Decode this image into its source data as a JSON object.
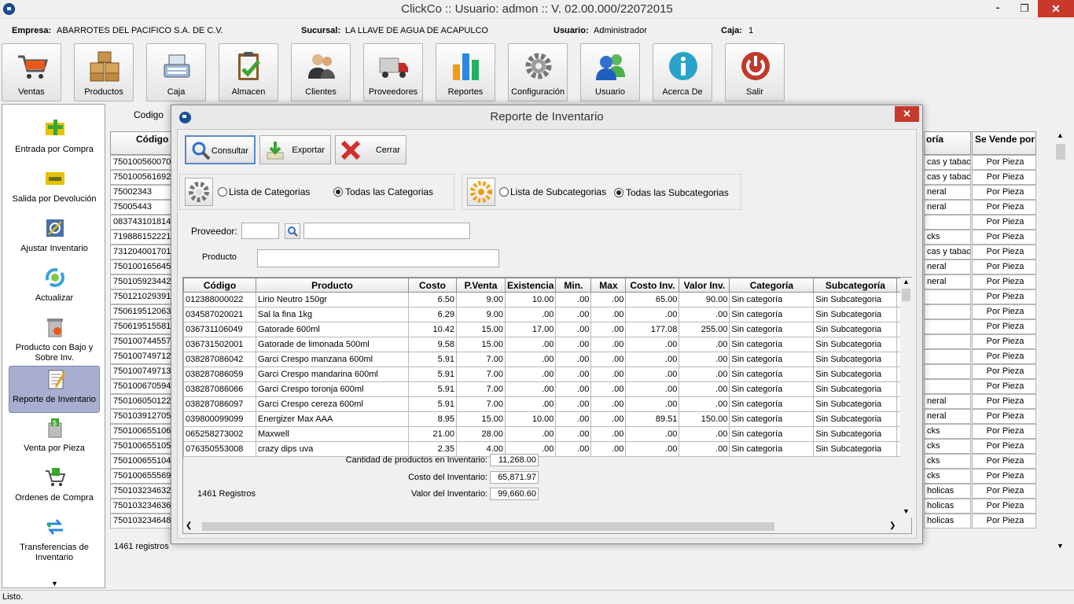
{
  "window": {
    "title": "ClickCo :: Usuario: admon :: V. 02.00.000/22072015"
  },
  "info": {
    "empresa_label": "Empresa:",
    "empresa_value": "ABARROTES DEL PACIFICO S.A. DE C.V.",
    "sucursal_label": "Sucursal:",
    "sucursal_value": "LA LLAVE DE AGUA DE ACAPULCO",
    "usuario_label": "Usuario:",
    "usuario_value": "Administrador",
    "caja_label": "Caja:",
    "caja_value": "1"
  },
  "toolbar": [
    {
      "label": "Ventas",
      "icon": "cart-icon"
    },
    {
      "label": "Productos",
      "icon": "boxes-icon"
    },
    {
      "label": "Caja",
      "icon": "cash-register-icon"
    },
    {
      "label": "Almacen",
      "icon": "clipboard-check-icon"
    },
    {
      "label": "Clientes",
      "icon": "customers-icon"
    },
    {
      "label": "Proveedores",
      "icon": "truck-icon"
    },
    {
      "label": "Reportes",
      "icon": "bar-chart-icon"
    },
    {
      "label": "Configuración",
      "icon": "gear-icon"
    },
    {
      "label": "Usuario",
      "icon": "users-icon"
    },
    {
      "label": "Acerca De",
      "icon": "info-icon"
    },
    {
      "label": "Salir",
      "icon": "power-icon"
    }
  ],
  "sidebar": [
    {
      "label": "Entrada por Compra",
      "icon": "plus-box-icon"
    },
    {
      "label": "Salida por Devolución",
      "icon": "minus-box-icon"
    },
    {
      "label": "Ajustar Inventario",
      "icon": "adjust-icon"
    },
    {
      "label": "Actualizar",
      "icon": "refresh-icon"
    },
    {
      "label": "Producto con Bajo y Sobre Inv.",
      "icon": "trash-box-icon"
    },
    {
      "label": "Reporte de Inventario",
      "icon": "report-icon"
    },
    {
      "label": "Venta por Pieza",
      "icon": "money-box-icon"
    },
    {
      "label": "Ordenes de Compra",
      "icon": "cart-order-icon"
    },
    {
      "label": "Transferencias de Inventario",
      "icon": "transfer-icon"
    }
  ],
  "background": {
    "codigo_label": "Codigo",
    "col_codigo": "Código",
    "col_categoria": "oría",
    "col_se_vende": "Se Vende por",
    "codes": [
      "750100560070",
      "750100561692",
      "75002343",
      "75005443",
      "083743101814",
      "719886152221",
      "731204001701",
      "750100165645",
      "750105923442",
      "750121029391",
      "750619512063",
      "750619515581",
      "750100744557",
      "750100749712",
      "750100749713",
      "750100670594",
      "750106050122",
      "750103912705",
      "750100655106",
      "750100655105",
      "750100655104",
      "750100655569",
      "750103234632",
      "750103234636",
      "750103234648"
    ],
    "categorias": [
      "cas y tabaco",
      "cas y tabaco",
      "neral",
      "neral",
      "",
      "cks",
      "cas y tabaco",
      "neral",
      "neral",
      "",
      "",
      "",
      "",
      "",
      "",
      "",
      "neral",
      "neral",
      "cks",
      "cks",
      "cks",
      "cks",
      "holicas",
      "holicas",
      "holicas"
    ],
    "se_vende": "Por Pieza",
    "registros": "1461 registros"
  },
  "dialog": {
    "title": "Reporte de Inventario",
    "buttons": {
      "consultar": "Consultar",
      "exportar": "Exportar",
      "cerrar": "Cerrar"
    },
    "categorias": {
      "lista": "Lista de Categorias",
      "todas": "Todas las Categorias",
      "selected": "todas"
    },
    "subcategorias": {
      "lista": "Lista de Subcategorias",
      "todas": "Todas las Subcategorias",
      "selected": "todas"
    },
    "proveedor_label": "Proveedor:",
    "producto_label": "Producto",
    "columns": [
      "Código",
      "Producto",
      "Costo",
      "P.Venta",
      "Existencia",
      "Min.",
      "Max",
      "Costo Inv.",
      "Valor Inv.",
      "Categoría",
      "Subcategoría"
    ],
    "rows": [
      [
        "012388000022",
        "Lirio Neutro 150gr",
        "6.50",
        "9.00",
        "10.00",
        ".00",
        ".00",
        "65.00",
        "90.00",
        "Sin categoría",
        "Sin Subcategoria"
      ],
      [
        "034587020021",
        "Sal la fina 1kg",
        "6.29",
        "9.00",
        ".00",
        ".00",
        ".00",
        ".00",
        ".00",
        "Sin categoría",
        "Sin Subcategoria"
      ],
      [
        "036731106049",
        "Gatorade 600ml",
        "10.42",
        "15.00",
        "17.00",
        ".00",
        ".00",
        "177.08",
        "255.00",
        "Sin categoría",
        "Sin Subcategoria"
      ],
      [
        "036731502001",
        "Gatorade de limonada 500ml",
        "9.58",
        "15.00",
        ".00",
        ".00",
        ".00",
        ".00",
        ".00",
        "Sin categoría",
        "Sin Subcategoria"
      ],
      [
        "038287086042",
        "Garci Crespo manzana 600ml",
        "5.91",
        "7.00",
        ".00",
        ".00",
        ".00",
        ".00",
        ".00",
        "Sin categoría",
        "Sin Subcategoria"
      ],
      [
        "038287086059",
        "Garci Crespo mandarina 600ml",
        "5.91",
        "7.00",
        ".00",
        ".00",
        ".00",
        ".00",
        ".00",
        "Sin categoría",
        "Sin Subcategoria"
      ],
      [
        "038287086066",
        "Garci Crespo toronja 600ml",
        "5.91",
        "7.00",
        ".00",
        ".00",
        ".00",
        ".00",
        ".00",
        "Sin categoría",
        "Sin Subcategoria"
      ],
      [
        "038287086097",
        "Garci Crespo cereza 600ml",
        "5.91",
        "7.00",
        ".00",
        ".00",
        ".00",
        ".00",
        ".00",
        "Sin categoría",
        "Sin Subcategoria"
      ],
      [
        "039800099099",
        "Energizer Max AAA",
        "8.95",
        "15.00",
        "10.00",
        ".00",
        ".00",
        "89.51",
        "150.00",
        "Sin categoría",
        "Sin Subcategoria"
      ],
      [
        "065258273002",
        "Maxwell",
        "21.00",
        "28.00",
        ".00",
        ".00",
        ".00",
        ".00",
        ".00",
        "Sin categoría",
        "Sin Subcategoria"
      ],
      [
        "076350553008",
        "crazy dips uva",
        "2.35",
        "4.00",
        ".00",
        ".00",
        ".00",
        ".00",
        ".00",
        "Sin categoría",
        "Sin Subcategoria"
      ]
    ],
    "summary": {
      "cantidad_label": "Cantidad de productos en Inventario:",
      "cantidad_value": "11,268.00",
      "costo_label": "Costo del Inventario:",
      "costo_value": "65,871.97",
      "valor_label": "Valor del Inventario:",
      "valor_value": "99,660.60"
    },
    "registros": "1461 Registros"
  },
  "status": {
    "text": "Listo."
  }
}
